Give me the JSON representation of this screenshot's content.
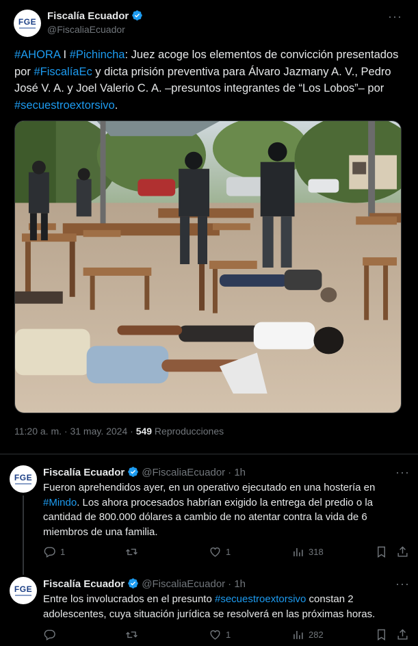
{
  "main_tweet": {
    "author_name": "Fiscalía Ecuador",
    "handle": "@FiscaliaEcuador",
    "avatar_text": "FGE",
    "text_parts": [
      {
        "text": "#AHORA",
        "hashtag": true
      },
      {
        "text": " I ",
        "hashtag": false
      },
      {
        "text": "#Pichincha",
        "hashtag": true
      },
      {
        "text": ": Juez acoge los elementos de convicción presentados por ",
        "hashtag": false
      },
      {
        "text": "#FiscalíaEc",
        "hashtag": true
      },
      {
        "text": " y dicta prisión preventiva para Álvaro Jazmany A. V., Pedro José V. A. y Joel Valerio C. A. –presuntos integrantes de “Los Lobos”– por ",
        "hashtag": false
      },
      {
        "text": "#secuestroextorsivo",
        "hashtag": true
      },
      {
        "text": ".",
        "hashtag": false
      }
    ],
    "timestamp": "11:20 a. m. · 31 may. 2024 · ",
    "views": "549",
    "views_label": " Reproducciones"
  },
  "replies": [
    {
      "author_name": "Fiscalía Ecuador",
      "handle": "@FiscaliaEcuador",
      "time": "· 1h",
      "avatar_text": "FGE",
      "text_parts": [
        {
          "text": "Fueron aprehendidos ayer, en un operativo ejecutado en una hostería en ",
          "hashtag": false
        },
        {
          "text": "#Mindo",
          "hashtag": true
        },
        {
          "text": ". Los ahora procesados habrían exigido la entrega del predio o la cantidad de 800.000 dólares a cambio de no atentar contra la vida de 6 miembros de una familia.",
          "hashtag": false
        }
      ],
      "replies_count": "1",
      "retweets_count": "",
      "likes_count": "1",
      "views_count": "318"
    },
    {
      "author_name": "Fiscalía Ecuador",
      "handle": "@FiscaliaEcuador",
      "time": "· 1h",
      "avatar_text": "FGE",
      "text_parts": [
        {
          "text": "Entre los involucrados en el presunto ",
          "hashtag": false
        },
        {
          "text": "#secuestroextorsivo",
          "hashtag": true
        },
        {
          "text": " constan 2 adolescentes, cuya situación jurídica se resolverá en las próximas horas.",
          "hashtag": false
        }
      ],
      "replies_count": "",
      "retweets_count": "",
      "likes_count": "1",
      "views_count": "282"
    }
  ],
  "icons": {
    "verified_color": "#1d9bf0",
    "hashtag_color": "#1d9bf0",
    "muted_color": "#71767b"
  }
}
